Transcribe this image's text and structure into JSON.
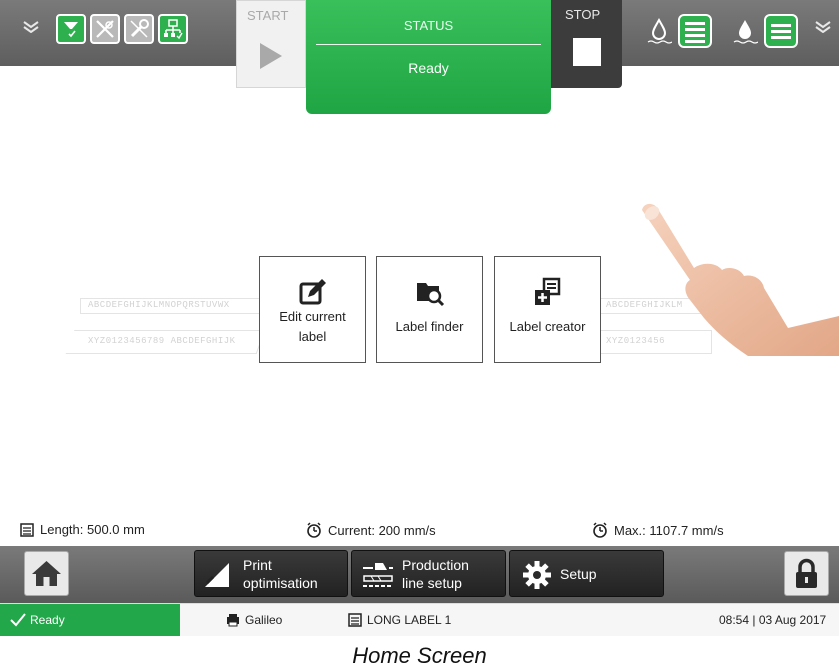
{
  "topbar": {
    "start_label": "START",
    "status_title": "STATUS",
    "status_value": "Ready",
    "stop_label": "STOP"
  },
  "background_strips": {
    "line1_left": "ABCDEFGHIJKLMNOPQRSTUVWX",
    "line2_left": "XYZ0123456789 ABCDEFGHIJK",
    "line1_right": "ABCDEFGHIJKLM",
    "line2_right": "XYZ0123456"
  },
  "tiles": [
    {
      "label_line1": "Edit current",
      "label_line2": "label",
      "icon": "edit-icon"
    },
    {
      "label": "Label finder",
      "icon": "folder-search-icon"
    },
    {
      "label": "Label creator",
      "icon": "label-add-icon"
    }
  ],
  "info": {
    "length": "Length: 500.0 mm",
    "current": "Current: 200 mm/s",
    "max": "Max.: 1107.7 mm/s"
  },
  "bottombar": {
    "print_line1": "Print",
    "print_line2": "optimisation",
    "production_line1": "Production",
    "production_line2": "line setup",
    "setup": "Setup"
  },
  "statusbar": {
    "state": "Ready",
    "printer": "Galileo",
    "label": "LONG LABEL 1",
    "datetime": "08:54 | 03 Aug 2017"
  },
  "caption": "Home Screen",
  "colors": {
    "accent_green": "#22a84a",
    "dark_button": "#2a2a2a",
    "bar_gray": "#6a6a6a"
  }
}
